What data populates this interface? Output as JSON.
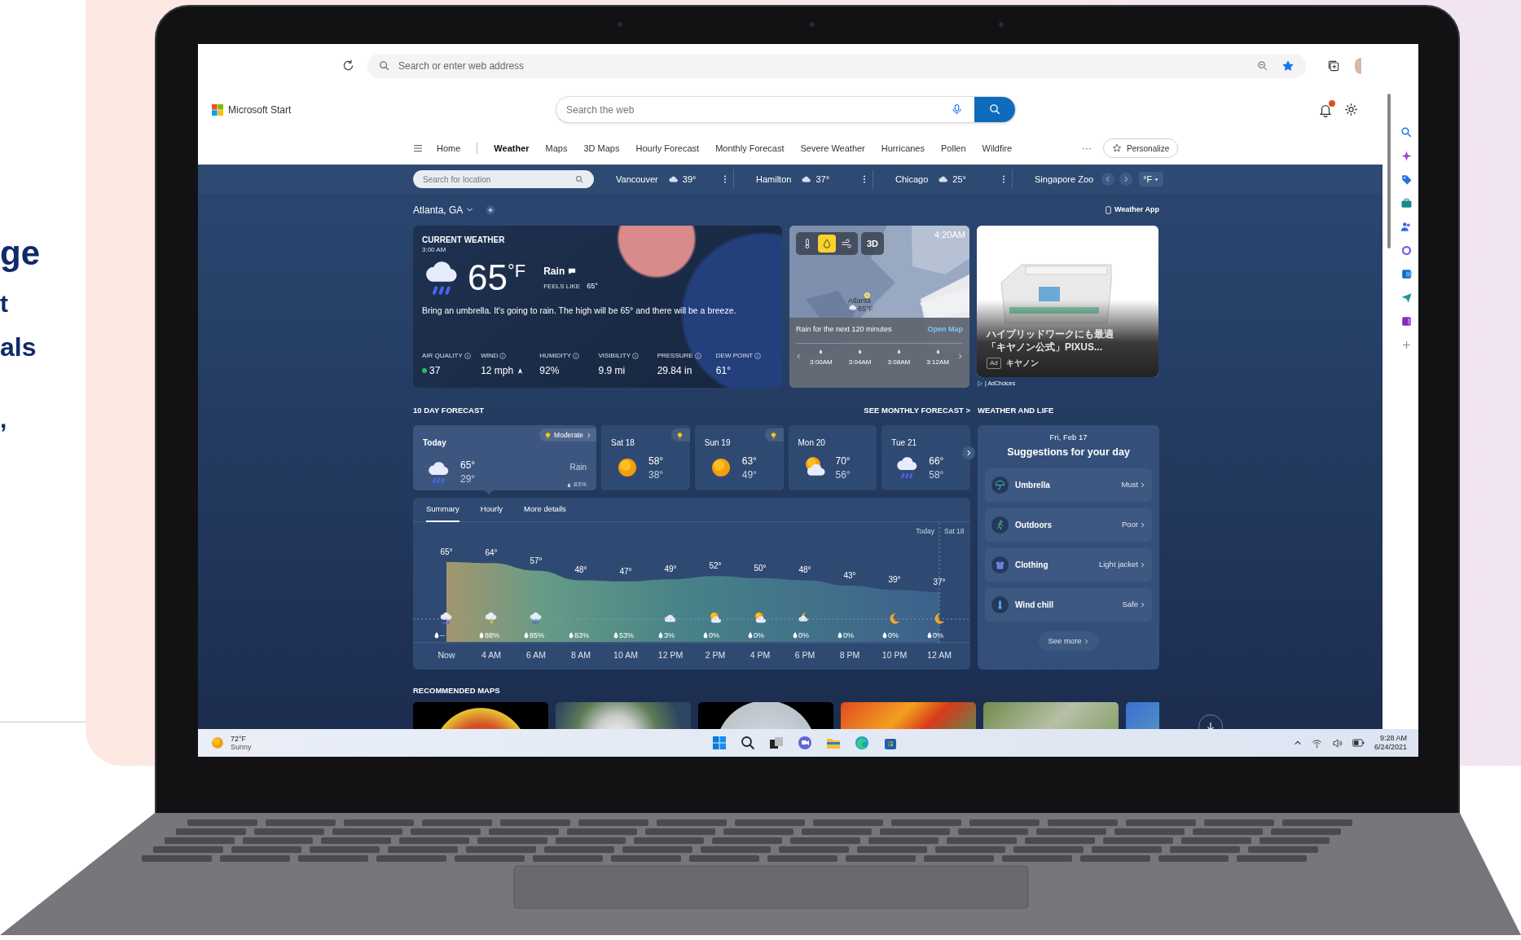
{
  "backdrop": {
    "fragments": [
      "ge",
      "t",
      "als",
      ","
    ]
  },
  "browser": {
    "address_placeholder": "Search or enter web address"
  },
  "header": {
    "brand": "Microsoft Start",
    "search_placeholder": "Search the web",
    "notifications": true
  },
  "nav": {
    "items": [
      {
        "label": "Home",
        "selected": false
      },
      {
        "label": "Weather",
        "selected": true
      },
      {
        "label": "Maps",
        "selected": false
      },
      {
        "label": "3D Maps",
        "selected": false
      },
      {
        "label": "Hourly Forecast",
        "selected": false
      },
      {
        "label": "Monthly Forecast",
        "selected": false
      },
      {
        "label": "Severe Weather",
        "selected": false
      },
      {
        "label": "Hurricanes",
        "selected": false
      },
      {
        "label": "Pollen",
        "selected": false
      },
      {
        "label": "Wildfire",
        "selected": false
      }
    ],
    "more": "···",
    "personalize": "Personalize"
  },
  "locations": {
    "search_placeholder": "Search for location",
    "items": [
      {
        "name": "Vancouver",
        "temp": "39°"
      },
      {
        "name": "Hamilton",
        "temp": "37°"
      },
      {
        "name": "Chicago",
        "temp": "25°"
      },
      {
        "name": "Singapore Zoo"
      }
    ],
    "unit": "°F"
  },
  "location": {
    "name": "Atlanta, GA",
    "app_link": "Weather App"
  },
  "current": {
    "heading": "CURRENT WEATHER",
    "time": "3:00 AM",
    "kind": "rain",
    "temp": "65",
    "unit": "°F",
    "condition": "Rain",
    "feels_like_label": "FEELS LIKE",
    "feels_like": "65°",
    "summary": "Bring an umbrella. It's going to rain. The high will be 65° and there will be a breeze.",
    "metrics": [
      {
        "kind": "aqi",
        "label": "AIR QUALITY",
        "value": "37",
        "color": "#22c55e"
      },
      {
        "kind": "wind",
        "label": "WIND",
        "value": "12 mph"
      },
      {
        "kind": "plain",
        "label": "HUMIDITY",
        "value": "92%"
      },
      {
        "kind": "plain",
        "label": "VISIBILITY",
        "value": "9.9 mi"
      },
      {
        "kind": "plain",
        "label": "PRESSURE",
        "value": "29.84 in"
      },
      {
        "kind": "plain",
        "label": "DEW POINT",
        "value": "61°"
      }
    ]
  },
  "map": {
    "layers": [
      {
        "kind": "temperature",
        "selected": false
      },
      {
        "kind": "precipitation",
        "selected": true
      },
      {
        "kind": "wind",
        "selected": false
      }
    ],
    "mode": "3D",
    "time": "4:20AM",
    "place": "Atlanta",
    "place_temp": "65°F",
    "caption": "Rain for the next 120 minutes",
    "link": "Open Map",
    "timeline": [
      "3:00AM",
      "3:04AM",
      "3:08AM",
      "3:12AM"
    ]
  },
  "ad": {
    "title_lines": [
      "ハイブリッドワークにも最適",
      "「キヤノン公式」PIXUS..."
    ],
    "badge": "Ad",
    "sponsor": "キヤノン",
    "adchoices": "| AdChoices"
  },
  "forecast": {
    "heading": "10 DAY FORECAST",
    "link": "SEE MONTHLY FORECAST >",
    "days": [
      {
        "label": "Today",
        "kind": "rain",
        "high": "65°",
        "low": "29°",
        "selected": true,
        "alert": true,
        "alert_text": "Moderate",
        "condition": "Rain",
        "precip": "83%"
      },
      {
        "label": "Sat 18",
        "kind": "sun",
        "high": "58°",
        "low": "38°",
        "selected": false,
        "alert": true
      },
      {
        "label": "Sun 19",
        "kind": "sun",
        "high": "63°",
        "low": "49°",
        "selected": false,
        "alert": true
      },
      {
        "label": "Mon 20",
        "kind": "partly",
        "high": "70°",
        "low": "56°",
        "selected": false,
        "alert": false
      },
      {
        "label": "Tue 21",
        "kind": "rain",
        "high": "66°",
        "low": "58°",
        "selected": false,
        "alert": false
      }
    ]
  },
  "hourly": {
    "tabs": [
      {
        "label": "Summary",
        "selected": true
      },
      {
        "label": "Hourly",
        "selected": false
      },
      {
        "label": "More details",
        "selected": false
      }
    ],
    "day_labels": [
      "Today",
      "Sat 18"
    ],
    "chart_data": {
      "type": "area",
      "categories": [
        "Now",
        "4 AM",
        "6 AM",
        "8 AM",
        "10 AM",
        "12 PM",
        "2 PM",
        "4 PM",
        "6 PM",
        "8 PM",
        "10 PM",
        "12 AM"
      ],
      "values": [
        65,
        64,
        57,
        48,
        47,
        49,
        52,
        50,
        48,
        43,
        39,
        37
      ],
      "value_labels": [
        "65°",
        "64°",
        "57°",
        "48°",
        "47°",
        "49°",
        "52°",
        "50°",
        "48°",
        "43°",
        "39°",
        "37°"
      ]
    },
    "hours": [
      {
        "kind": "rain",
        "precip": "--"
      },
      {
        "kind": "thunder",
        "precip": "88%"
      },
      {
        "kind": "rain",
        "precip": "85%"
      },
      {
        "kind": "none",
        "precip": "83%"
      },
      {
        "kind": "none",
        "precip": "53%"
      },
      {
        "kind": "cloud",
        "precip": "3%"
      },
      {
        "kind": "partly",
        "precip": "0%"
      },
      {
        "kind": "partly",
        "precip": "0%"
      },
      {
        "kind": "night_cloud",
        "precip": "0%"
      },
      {
        "kind": "none",
        "precip": "0%"
      },
      {
        "kind": "moon",
        "precip": "0%"
      },
      {
        "kind": "moon",
        "precip": "0%"
      }
    ]
  },
  "life": {
    "heading": "WEATHER AND LIFE",
    "date": "Fri, Feb 17",
    "title": "Suggestions for your day",
    "items": [
      {
        "kind": "umbrella",
        "label": "Umbrella",
        "value": "Must"
      },
      {
        "kind": "outdoors",
        "label": "Outdoors",
        "value": "Poor"
      },
      {
        "kind": "clothing",
        "label": "Clothing",
        "value": "Light jacket"
      },
      {
        "kind": "windchill",
        "label": "Wind chill",
        "value": "Safe"
      }
    ],
    "more": "See more"
  },
  "maps": {
    "heading": "RECOMMENDED MAPS",
    "tiles": [
      {
        "kind": "globe"
      },
      {
        "kind": "satellite"
      },
      {
        "kind": "precipitation"
      },
      {
        "kind": "heat"
      },
      {
        "kind": "terrain"
      },
      {
        "kind": "radar"
      }
    ]
  },
  "taskbar": {
    "weather_temp": "72°F",
    "weather_text": "Sunny",
    "time": "9:28 AM",
    "date": "6/24/2021"
  }
}
